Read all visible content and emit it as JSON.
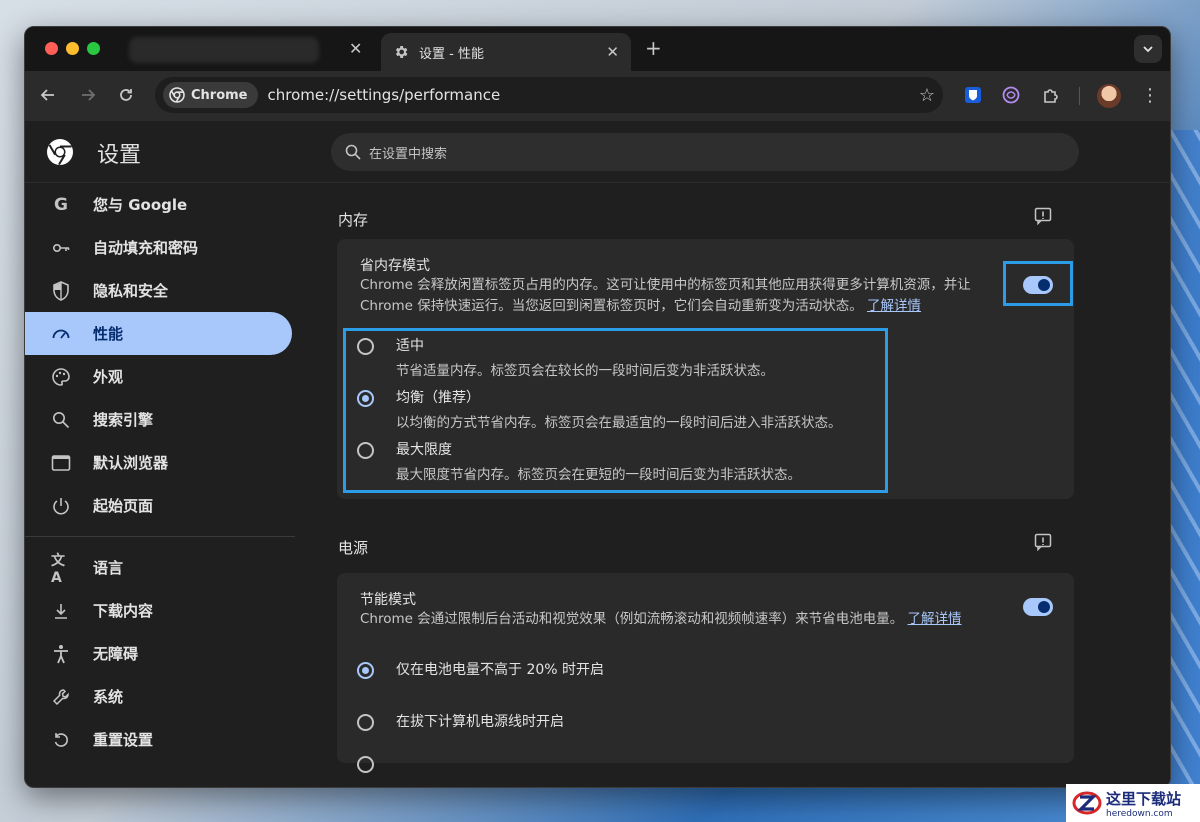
{
  "tab": {
    "title": "设置 - 性能"
  },
  "omnibox": {
    "chip_label": "Chrome",
    "url": "chrome://settings/performance"
  },
  "settings": {
    "title": "设置",
    "search_placeholder": "在设置中搜索"
  },
  "sidebar": {
    "items": [
      {
        "label": "您与 Google",
        "icon": "google-icon"
      },
      {
        "label": "自动填充和密码",
        "icon": "key-icon"
      },
      {
        "label": "隐私和安全",
        "icon": "shield-icon"
      },
      {
        "label": "性能",
        "icon": "speedometer-icon",
        "active": true
      },
      {
        "label": "外观",
        "icon": "palette-icon"
      },
      {
        "label": "搜索引擎",
        "icon": "search-icon"
      },
      {
        "label": "默认浏览器",
        "icon": "browser-window-icon"
      },
      {
        "label": "起始页面",
        "icon": "power-icon"
      },
      {
        "label": "语言",
        "icon": "translate-icon"
      },
      {
        "label": "下载内容",
        "icon": "download-icon"
      },
      {
        "label": "无障碍",
        "icon": "accessibility-icon"
      },
      {
        "label": "系统",
        "icon": "wrench-icon"
      },
      {
        "label": "重置设置",
        "icon": "reset-icon"
      }
    ]
  },
  "memory": {
    "section_title": "内存",
    "mode_title": "省内存模式",
    "mode_desc_line1": "Chrome 会释放闲置标签页占用的内存。这可让使用中的标签页和其他应用获得更多计算机资源，并让",
    "mode_desc_line2": "Chrome 保持快速运行。当您返回到闲置标签页时，它们会自动重新变为活动状态。",
    "learn_more": "了解详情",
    "enabled": true,
    "options": [
      {
        "label": "适中",
        "desc": "节省适量内存。标签页会在较长的一段时间后变为非活跃状态。",
        "checked": false
      },
      {
        "label": "均衡（推荐）",
        "desc": "以均衡的方式节省内存。标签页会在最适宜的一段时间后进入非活跃状态。",
        "checked": true
      },
      {
        "label": "最大限度",
        "desc": "最大限度节省内存。标签页会在更短的一段时间后变为非活跃状态。",
        "checked": false
      }
    ]
  },
  "power": {
    "section_title": "电源",
    "mode_title": "节能模式",
    "mode_desc": "Chrome 会通过限制后台活动和视觉效果（例如流畅滚动和视频帧速率）来节省电池电量。",
    "learn_more": "了解详情",
    "enabled": true,
    "options": [
      {
        "label": "仅在电池电量不高于 20% 时开启",
        "checked": true
      },
      {
        "label": "在拔下计算机电源线时开启",
        "checked": false
      }
    ]
  },
  "watermark": {
    "cn": "这里下载站",
    "en": "heredown.com"
  },
  "colors": {
    "accent": "#a8c7fa",
    "highlight": "#2d9ce8",
    "background": "#1f1f1f",
    "card": "#2a2a2a"
  }
}
